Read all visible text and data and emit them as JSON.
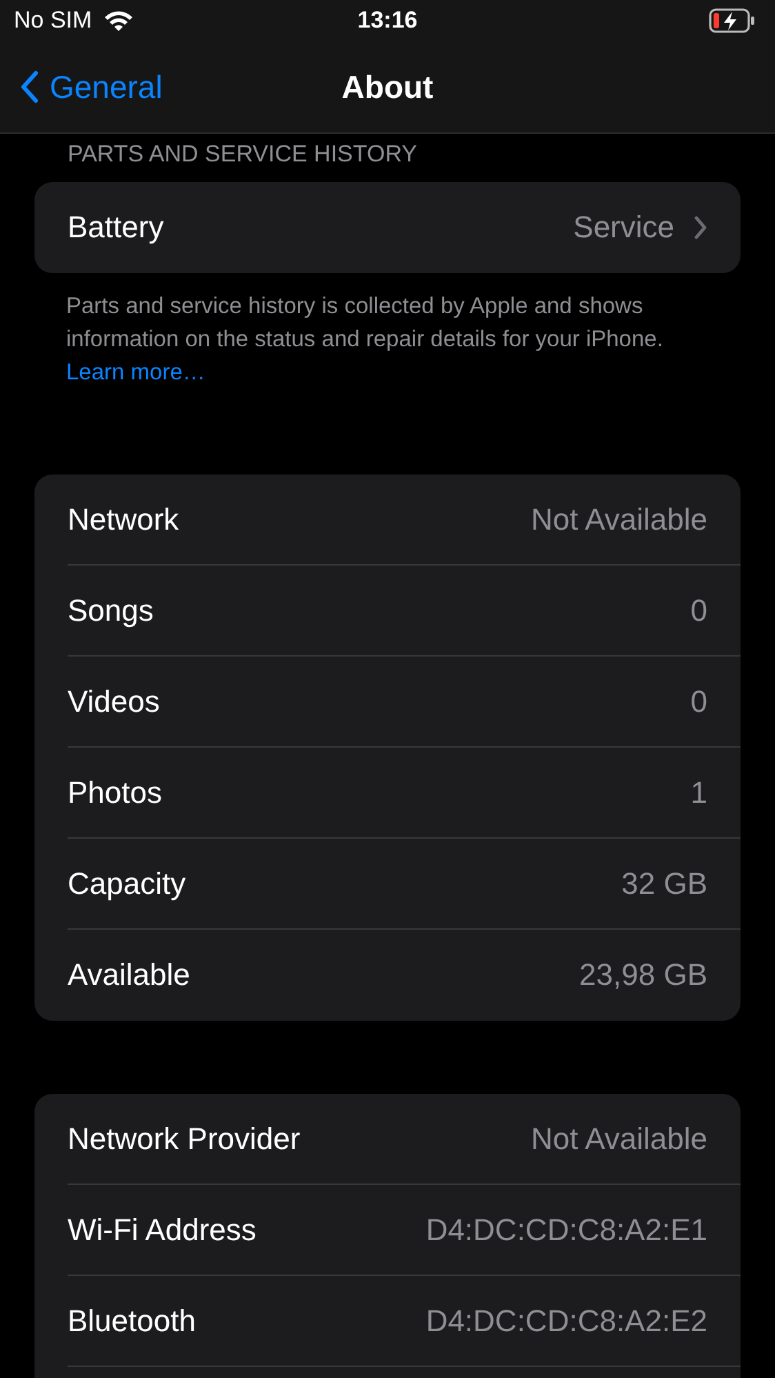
{
  "status_bar": {
    "carrier": "No SIM",
    "time": "13:16",
    "charging": true
  },
  "nav": {
    "back": "General",
    "title": "About"
  },
  "sections": [
    {
      "header": "PARTS AND SERVICE HISTORY",
      "rows": [
        {
          "label": "Battery",
          "value": "Service",
          "chevron": true
        }
      ],
      "footer": "Parts and service history is collected by Apple and shows information on the status and repair details for your iPhone.",
      "footer_link": "Learn more…"
    },
    {
      "rows": [
        {
          "label": "Network",
          "value": "Not Available",
          "chevron": false
        },
        {
          "label": "Songs",
          "value": "0",
          "chevron": false
        },
        {
          "label": "Videos",
          "value": "0",
          "chevron": false
        },
        {
          "label": "Photos",
          "value": "1",
          "chevron": false
        },
        {
          "label": "Capacity",
          "value": "32 GB",
          "chevron": false
        },
        {
          "label": "Available",
          "value": "23,98 GB",
          "chevron": false
        }
      ]
    },
    {
      "rows": [
        {
          "label": "Network Provider",
          "value": "Not Available",
          "chevron": false
        },
        {
          "label": "Wi-Fi Address",
          "value": "D4:DC:CD:C8:A2:E1",
          "chevron": false
        },
        {
          "label": "Bluetooth",
          "value": "D4:DC:CD:C8:A2:E2",
          "chevron": false
        }
      ],
      "cut_off": true
    }
  ]
}
